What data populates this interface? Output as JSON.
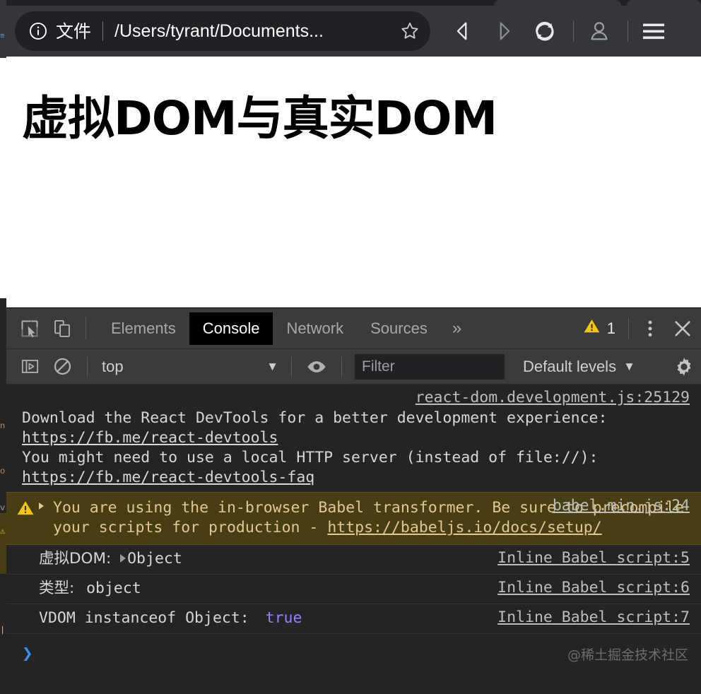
{
  "browser": {
    "omnibox": {
      "info_icon": "info-circle-icon",
      "scheme_label": "文件",
      "url": "/Users/tyrant/Documents...",
      "star_icon": "bookmark-star-icon"
    },
    "nav": {
      "back_icon": "back-arrow-icon",
      "forward_icon": "forward-arrow-icon",
      "reload_icon": "reload-icon",
      "profile_icon": "profile-person-icon",
      "menu_icon": "hamburger-menu-icon"
    }
  },
  "page": {
    "title": "虚拟DOM与真实DOM"
  },
  "devtools": {
    "toolbar": {
      "inspect_icon": "inspect-element-icon",
      "device_icon": "device-toolbar-icon",
      "tabs": [
        {
          "label": "Elements",
          "active": false
        },
        {
          "label": "Console",
          "active": true
        },
        {
          "label": "Network",
          "active": false
        },
        {
          "label": "Sources",
          "active": false
        }
      ],
      "more_tabs": "»",
      "warning_count": "1",
      "warning_icon": "warning-triangle-icon",
      "kebab_icon": "more-options-icon",
      "close_icon": "close-icon"
    },
    "filterbar": {
      "sidebar_icon": "console-sidebar-icon",
      "clear_icon": "clear-console-icon",
      "context": "top",
      "context_caret": "▼",
      "eye_icon": "live-expression-eye-icon",
      "filter_placeholder": "Filter",
      "filter_value": "",
      "levels_label": "Default levels",
      "levels_caret": "▼",
      "settings_icon": "gear-icon"
    },
    "messages": [
      {
        "type": "info",
        "text_1": "Download the React DevTools for a better development experience: ",
        "link_1": "https://fb.me/react-devtools",
        "text_2": "\nYou might need to use a local HTTP server (instead of file://): ",
        "link_2": "https://fb.me/react-devtools-faq",
        "source": "react-dom.development.js:25129"
      },
      {
        "type": "warning",
        "text_1": "You are using the in-browser Babel transformer. Be sure to precompile your scripts for production - ",
        "link_1": "https://babeljs.io/docs/setup/",
        "source": "babel.min.js:24"
      },
      {
        "type": "log",
        "label": "虚拟DOM: ",
        "value": "Object",
        "expandable": true,
        "source": "Inline Babel script:5"
      },
      {
        "type": "log",
        "label": "类型: ",
        "value": "object",
        "expandable": false,
        "source": "Inline Babel script:6"
      },
      {
        "type": "log",
        "label": "VDOM instanceof Object: ",
        "value": "true",
        "value_kind": "boolean",
        "expandable": false,
        "source": "Inline Babel script:7"
      }
    ],
    "prompt": {
      "caret": "❯"
    },
    "watermark": "@稀土掘金技术社区"
  },
  "colors": {
    "chrome_toolbar": "#35363a",
    "omnibox": "#202124",
    "devtools_bg": "#242424",
    "devtools_toolbar": "#3b3b3b",
    "active_tab_bg": "#000000",
    "warning_row_bg": "#473e14",
    "warning_text": "#e2c792",
    "warning_badge": "#f5c518",
    "boolean_value": "#9a7fff",
    "prompt_caret": "#3b8cf4",
    "link_text": "#bdbdbd"
  }
}
